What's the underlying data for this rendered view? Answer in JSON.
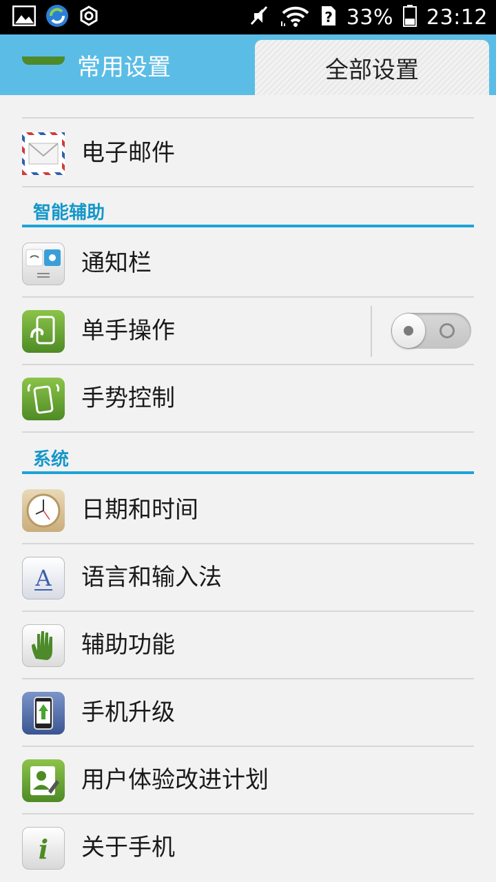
{
  "status_bar": {
    "battery_percent": "33%",
    "time": "23:12",
    "icons": [
      "gallery-icon",
      "sync-app-icon",
      "settings-ring-icon",
      "mute-icon",
      "wifi-icon",
      "no-sim-icon",
      "battery-icon"
    ]
  },
  "tabs": {
    "common": "常用设置",
    "all": "全部设置"
  },
  "email": {
    "label": "电子邮件"
  },
  "sections": {
    "smart_assist": "智能辅助",
    "system": "系统"
  },
  "smart_items": {
    "notification": "通知栏",
    "one_hand": "单手操作",
    "gesture": "手势控制"
  },
  "one_hand_toggle": {
    "state": "off"
  },
  "system_items": {
    "datetime": "日期和时间",
    "language": "语言和输入法",
    "accessibility": "辅助功能",
    "upgrade": "手机升级",
    "ux_plan": "用户体验改进计划",
    "about": "关于手机"
  },
  "colors": {
    "tab_bar": "#5bbde6",
    "section_accent": "#1ca3d6"
  }
}
